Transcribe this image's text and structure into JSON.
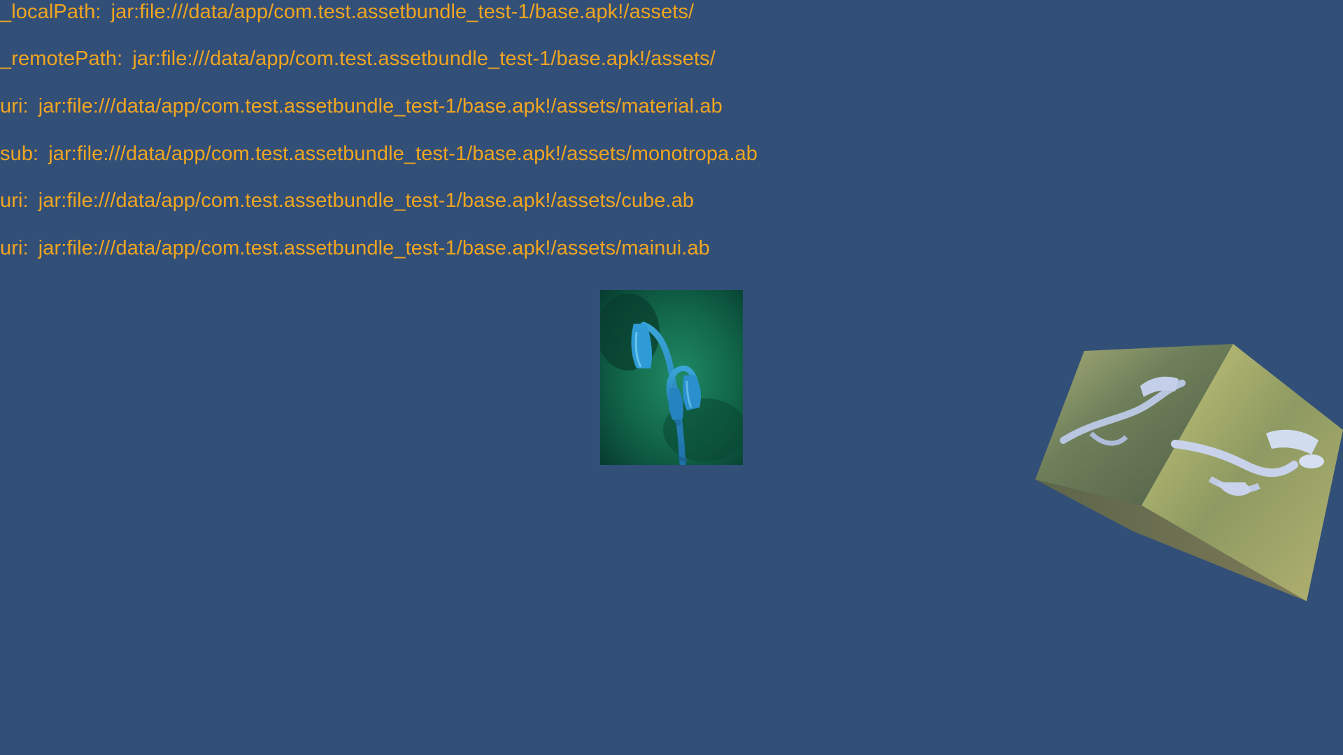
{
  "log_lines": [
    {
      "key": "_localPath:",
      "value": "jar:file:///data/app/com.test.assetbundle_test-1/base.apk!/assets/"
    },
    {
      "key": "_remotePath:",
      "value": "jar:file:///data/app/com.test.assetbundle_test-1/base.apk!/assets/"
    },
    {
      "key": "uri:",
      "value": "jar:file:///data/app/com.test.assetbundle_test-1/base.apk!/assets/material.ab"
    },
    {
      "key": "sub:",
      "value": "jar:file:///data/app/com.test.assetbundle_test-1/base.apk!/assets/monotropa.ab"
    },
    {
      "key": "uri:",
      "value": "jar:file:///data/app/com.test.assetbundle_test-1/base.apk!/assets/cube.ab"
    },
    {
      "key": "uri:",
      "value": "jar:file:///data/app/com.test.assetbundle_test-1/base.apk!/assets/mainui.ab"
    }
  ],
  "colors": {
    "background": "#324f78",
    "log_text": "#f0a520"
  },
  "objects": {
    "sprite_icon": "monotropa-flower-image",
    "cube_icon": "textured-cube"
  }
}
